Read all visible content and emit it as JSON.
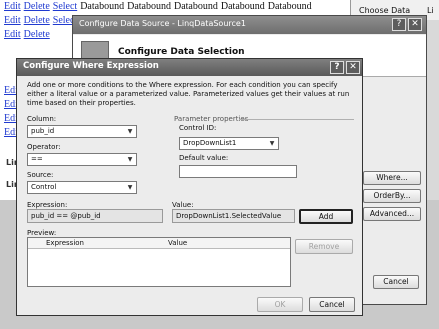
{
  "background": {
    "row_cells": [
      "Edit",
      "Delete",
      "Select",
      "Databound",
      "Databound",
      "Databound",
      "Databound",
      "Databound"
    ],
    "short_rows": [
      "Edit",
      "Edit",
      "Edit",
      "Edit",
      "Edit",
      "Edit",
      "Edit"
    ],
    "side_fragments": [
      "Lin",
      "Lin"
    ],
    "right_panel_label": "Choose Data Source:",
    "right_panel_value": "Li"
  },
  "configure_data_source": {
    "title": "Configure Data Source - LinqDataSource1",
    "header": "Configure Data Selection",
    "buttons": {
      "where": "Where...",
      "orderby": "OrderBy...",
      "advanced": "Advanced..."
    },
    "cancel": "Cancel"
  },
  "where_dialog": {
    "title": "Configure Where Expression",
    "help_icon": "?",
    "close_icon": "✕",
    "intro": "Add one or more conditions to the Where expression. For each condition you can specify either a literal value or a parameterized value. Parameterized values get their values at run time based on their properties.",
    "column_label": "Column:",
    "column_value": "pub_id",
    "operator_label": "Operator:",
    "operator_value": "==",
    "source_label": "Source:",
    "source_value": "Control",
    "param_group_label": "Parameter properties",
    "control_id_label": "Control ID:",
    "control_id_value": "DropDownList1",
    "default_value_label": "Default value:",
    "default_value_value": "",
    "expression_label": "Expression:",
    "expression_value": "pub_id == @pub_id",
    "value_label": "Value:",
    "value_value": "DropDownList1.SelectedValue",
    "add_button": "Add",
    "preview_label": "Preview:",
    "preview_columns": [
      "Expression",
      "Value"
    ],
    "remove_button": "Remove",
    "ok_button": "OK",
    "cancel_button": "Cancel"
  }
}
